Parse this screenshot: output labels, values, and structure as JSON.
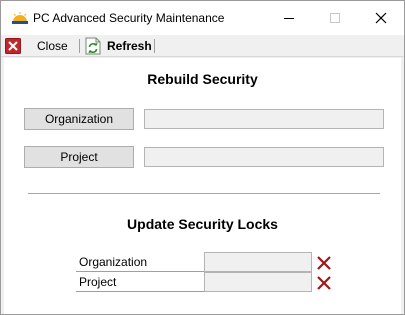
{
  "window": {
    "title": "PC Advanced Security Maintenance"
  },
  "toolbar": {
    "close_label": "Close",
    "refresh_label": "Refresh"
  },
  "rebuild": {
    "title": "Rebuild Security",
    "organization_button": "Organization",
    "organization_value": "",
    "project_button": "Project",
    "project_value": ""
  },
  "locks": {
    "title": "Update Security Locks",
    "rows": [
      {
        "label": "Organization",
        "value": ""
      },
      {
        "label": "Project",
        "value": ""
      }
    ]
  },
  "colors": {
    "close_red": "#c0262c",
    "refresh_green": "#2e8b2e",
    "lock_x_red": "#a01818"
  },
  "icons": {
    "app": "sunrise-icon",
    "toolbar_close": "close-box-icon",
    "toolbar_refresh": "refresh-icon",
    "lock_clear": "x-icon"
  }
}
